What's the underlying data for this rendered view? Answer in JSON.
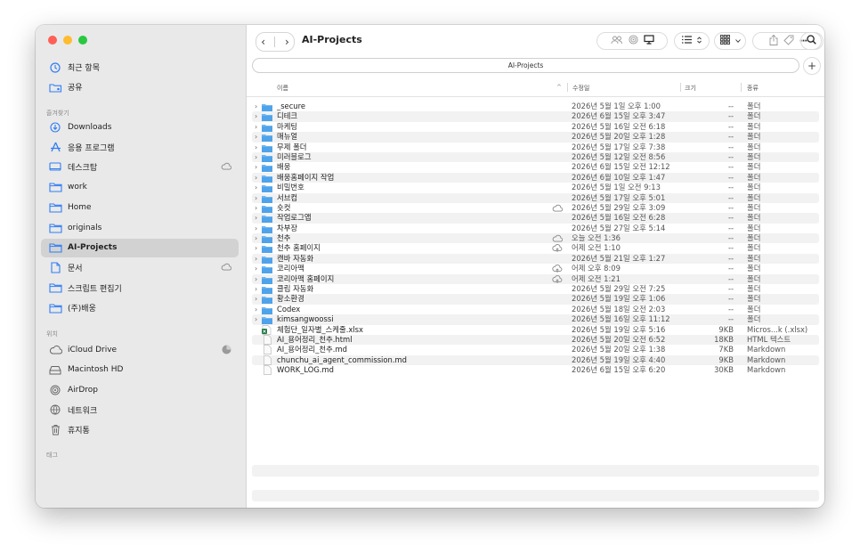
{
  "sidebar": {
    "recent": "최근 항목",
    "shared": "공유",
    "favorites_header": "즐겨찾기",
    "favorites": [
      {
        "label": "Downloads",
        "icon": "download-icon"
      },
      {
        "label": "응용 프로그램",
        "icon": "applications-icon"
      },
      {
        "label": "데스크탑",
        "icon": "desktop-icon",
        "cloud": true
      },
      {
        "label": "work",
        "icon": "folder-icon"
      },
      {
        "label": "Home",
        "icon": "folder-icon"
      },
      {
        "label": "originals",
        "icon": "folder-icon"
      },
      {
        "label": "AI-Projects",
        "icon": "folder-icon",
        "selected": true
      },
      {
        "label": "문서",
        "icon": "document-icon",
        "cloud": true
      },
      {
        "label": "스크립트 편집기",
        "icon": "folder-icon"
      },
      {
        "label": "(주)배웅",
        "icon": "folder-icon"
      }
    ],
    "locations_header": "위치",
    "locations": [
      {
        "label": "iCloud Drive",
        "icon": "cloud-icon",
        "progress": true
      },
      {
        "label": "Macintosh HD",
        "icon": "disk-icon"
      },
      {
        "label": "AirDrop",
        "icon": "airdrop-icon"
      },
      {
        "label": "네트워크",
        "icon": "network-icon"
      },
      {
        "label": "휴지통",
        "icon": "trash-icon"
      }
    ],
    "tags_header": "태그"
  },
  "toolbar": {
    "back": "‹",
    "forward": "›",
    "title": "AI-Projects"
  },
  "pathbar": {
    "label": "AI-Projects",
    "add": "+"
  },
  "columns": {
    "name": "이름",
    "sort_indicator": "^",
    "modified": "수정일",
    "size": "크기",
    "kind": "종류"
  },
  "files": [
    {
      "name": "_secure",
      "type": "folder",
      "date": "2026년 5월 1일 오후 1:00",
      "size": "--",
      "kind": "폴더"
    },
    {
      "name": "디테크",
      "type": "folder",
      "date": "2026년 6월 15일 오후 3:47",
      "size": "--",
      "kind": "폴더"
    },
    {
      "name": "마케팅",
      "type": "folder",
      "date": "2026년 5월 16일 오전 6:18",
      "size": "--",
      "kind": "폴더"
    },
    {
      "name": "매뉴얼",
      "type": "folder",
      "date": "2026년 5월 20일 오후 1:28",
      "size": "--",
      "kind": "폴더"
    },
    {
      "name": "무제 폴더",
      "type": "folder",
      "date": "2026년 5월 17일 오후 7:38",
      "size": "--",
      "kind": "폴더"
    },
    {
      "name": "미러블로그",
      "type": "folder",
      "date": "2026년 5월 12일 오전 8:56",
      "size": "--",
      "kind": "폴더"
    },
    {
      "name": "배웅",
      "type": "folder",
      "date": "2026년 6월 15일 오전 12:12",
      "size": "--",
      "kind": "폴더"
    },
    {
      "name": "배웅홈페이지 작업",
      "type": "folder",
      "date": "2026년 6월 10일 오후 1:47",
      "size": "--",
      "kind": "폴더"
    },
    {
      "name": "비밀번호",
      "type": "folder",
      "date": "2026년 5월 1일 오전 9:13",
      "size": "--",
      "kind": "폴더"
    },
    {
      "name": "서브컴",
      "type": "folder",
      "date": "2026년 5월 17일 오후 5:01",
      "size": "--",
      "kind": "폴더"
    },
    {
      "name": "숏컷",
      "type": "folder",
      "date": "2026년 5월 29일 오후 3:09",
      "size": "--",
      "kind": "폴더",
      "cloud": "cloud"
    },
    {
      "name": "작업로그앱",
      "type": "folder",
      "date": "2026년 5월 16일 오전 6:28",
      "size": "--",
      "kind": "폴더"
    },
    {
      "name": "차부장",
      "type": "folder",
      "date": "2026년 5월 27일 오후 5:14",
      "size": "--",
      "kind": "폴더"
    },
    {
      "name": "천추",
      "type": "folder",
      "date": "오늘 오전 1:36",
      "size": "--",
      "kind": "폴더",
      "cloud": "cloud"
    },
    {
      "name": "천추 홈페이지",
      "type": "folder",
      "date": "어제 오전 1:10",
      "size": "--",
      "kind": "폴더",
      "cloud": "upload"
    },
    {
      "name": "캔바 자동화",
      "type": "folder",
      "date": "2026년 5월 21일 오후 1:27",
      "size": "--",
      "kind": "폴더"
    },
    {
      "name": "코리아맥",
      "type": "folder",
      "date": "어제 오후 8:09",
      "size": "--",
      "kind": "폴더",
      "cloud": "upload"
    },
    {
      "name": "코리아맥 홈페이지",
      "type": "folder",
      "date": "어제 오전 1:21",
      "size": "--",
      "kind": "폴더",
      "cloud": "upload"
    },
    {
      "name": "클립 자동화",
      "type": "folder",
      "date": "2026년 5월 29일 오전 7:25",
      "size": "--",
      "kind": "폴더"
    },
    {
      "name": "황소환경",
      "type": "folder",
      "date": "2026년 5월 19일 오후 1:06",
      "size": "--",
      "kind": "폴더"
    },
    {
      "name": "Codex",
      "type": "folder",
      "date": "2026년 5월 18일 오전 2:03",
      "size": "--",
      "kind": "폴더"
    },
    {
      "name": "kimsangwoossi",
      "type": "folder",
      "date": "2026년 5월 16일 오후 11:12",
      "size": "--",
      "kind": "폴더"
    },
    {
      "name": "체험단_일자별_스케줄.xlsx",
      "type": "xlsx",
      "date": "2026년 5월 19일 오후 5:16",
      "size": "9KB",
      "kind": "Micros...k (.xlsx)"
    },
    {
      "name": "AI_용어정리_천추.html",
      "type": "doc",
      "date": "2026년 5월 20일 오전 6:52",
      "size": "18KB",
      "kind": "HTML 텍스트"
    },
    {
      "name": "AI_용어정리_천추.md",
      "type": "doc",
      "date": "2026년 5월 20일 오후 1:38",
      "size": "7KB",
      "kind": "Markdown"
    },
    {
      "name": "chunchu_ai_agent_commission.md",
      "type": "doc",
      "date": "2026년 5월 19일 오후 4:40",
      "size": "9KB",
      "kind": "Markdown"
    },
    {
      "name": "WORK_LOG.md",
      "type": "doc",
      "date": "2026년 6월 15일 오후 6:20",
      "size": "30KB",
      "kind": "Markdown"
    }
  ]
}
